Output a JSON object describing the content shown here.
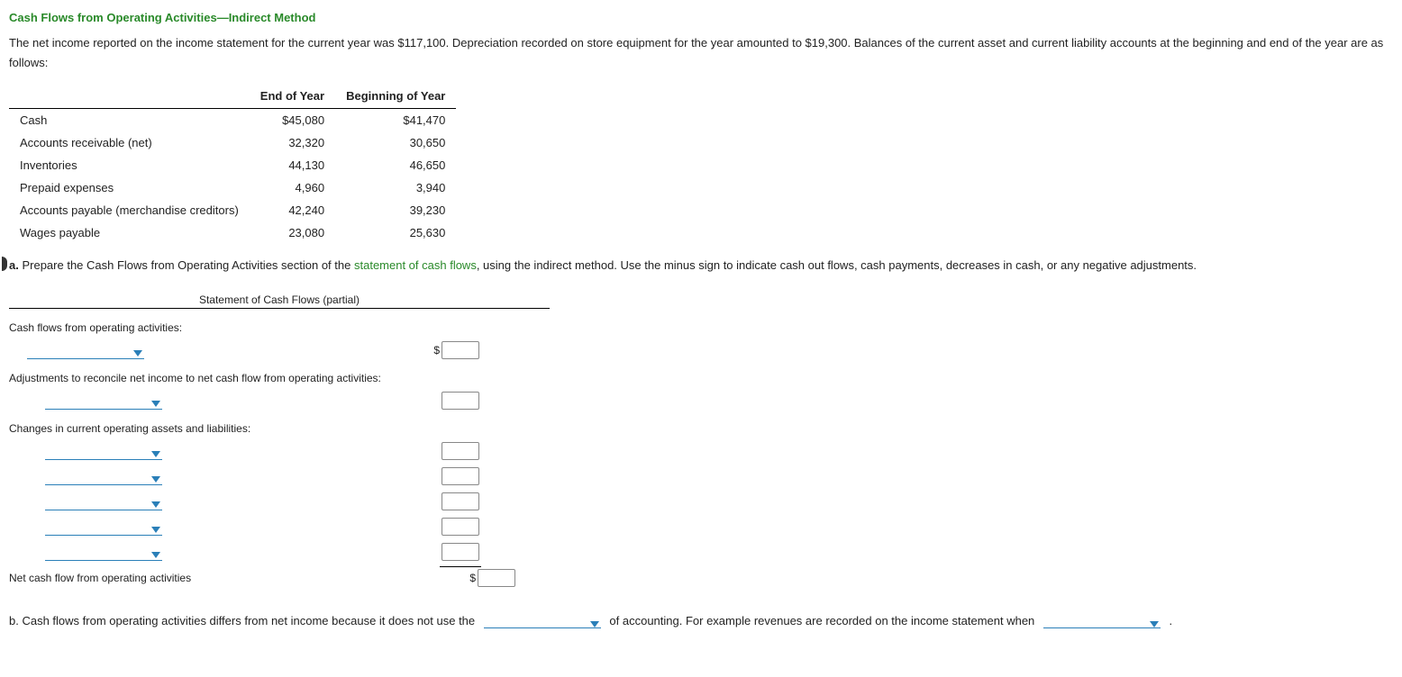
{
  "title_part1": "Cash Flows from Operating Activities",
  "title_dash": "—",
  "title_part2": "Indirect Method",
  "intro": "The net income reported on the income statement for the current year was $117,100. Depreciation recorded on store equipment for the year amounted to $19,300. Balances of the current asset and current liability accounts at the beginning and end of the year are as follows:",
  "balances": {
    "cols": [
      "",
      "End of Year",
      "Beginning of Year"
    ],
    "rows": [
      {
        "label": "Cash",
        "end": "$45,080",
        "beg": "$41,470"
      },
      {
        "label": "Accounts receivable (net)",
        "end": "32,320",
        "beg": "30,650"
      },
      {
        "label": "Inventories",
        "end": "44,130",
        "beg": "46,650"
      },
      {
        "label": "Prepaid expenses",
        "end": "4,960",
        "beg": "3,940"
      },
      {
        "label": "Accounts payable (merchandise creditors)",
        "end": "42,240",
        "beg": "39,230"
      },
      {
        "label": "Wages payable",
        "end": "23,080",
        "beg": "25,630"
      }
    ]
  },
  "qa": {
    "letter": "a.",
    "pre": "Prepare the Cash Flows from Operating Activities section of the ",
    "link": "statement of cash flows",
    "post": ", using the indirect method. Use the minus sign to indicate cash out flows, cash payments, decreases in cash, or any negative adjustments."
  },
  "ws": {
    "head": "Statement of Cash Flows (partial)",
    "line1": "Cash flows from operating activities:",
    "line_adj": "Adjustments to reconcile net income to net cash flow from operating activities:",
    "line_changes": "Changes in current operating assets and liabilities:",
    "net": "Net cash flow from operating activities",
    "dollar": "$"
  },
  "qb": {
    "letter": "b.",
    "t1": "Cash flows from operating activities differs from net income because it does not use the",
    "t2": "of accounting. For example revenues are recorded on the income statement when",
    "t3": "."
  }
}
